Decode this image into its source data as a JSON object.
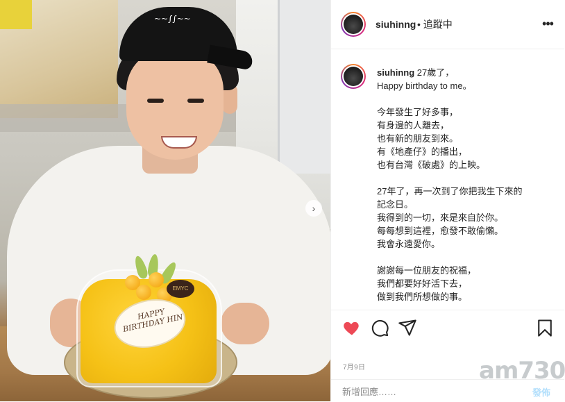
{
  "header": {
    "username": "siuhinng",
    "follow_status": "• 追蹤中",
    "more_icon": "more-horizontal-icon"
  },
  "caption": {
    "username": "siuhinng",
    "text": "27歲了，\nHappy birthday to me。\n\n今年發生了好多事，\n有身邊的人離去，\n也有新的朋友到來。\n有《地產仔》的播出，\n也有台灣《破處》的上映。\n\n27年了，再一次到了你把我生下來的\n記念日。\n我得到的一切，來是來自於你。\n每每想到這裡，愈發不敢偷懶。\n我會永遠愛你。\n\n謝謝每一位朋友的祝福，\n我們都要好好活下去，\n做到我們所想做的事。"
  },
  "photo": {
    "cake_plaque": "HAPPY BIRTHDAY HIN",
    "cake_brand": "EMYC"
  },
  "actions": {
    "like_icon": "heart-filled-icon",
    "comment_icon": "comment-icon",
    "share_icon": "send-icon",
    "save_icon": "bookmark-icon",
    "like_color": "#ed4956"
  },
  "timestamp": "7月9日",
  "add_comment": {
    "placeholder": "新增回應……",
    "post_label": "發佈"
  },
  "watermark": "am730"
}
